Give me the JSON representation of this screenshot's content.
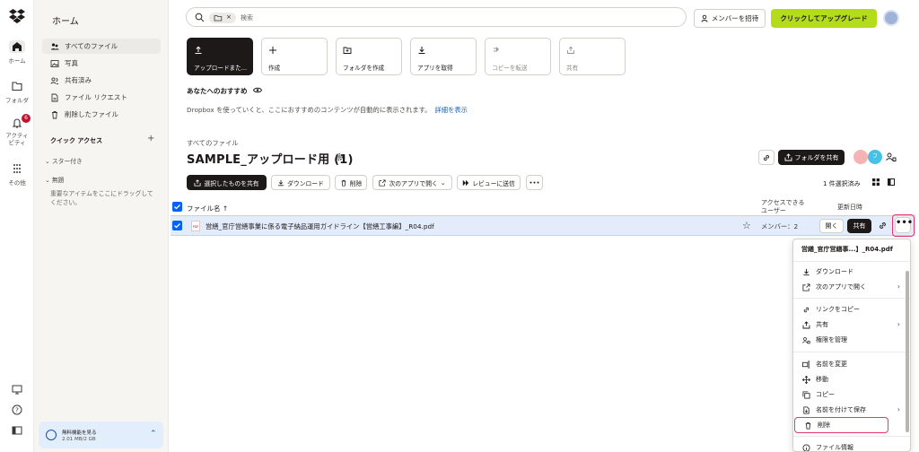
{
  "app": {
    "brand": "Dropbox",
    "accent": "#0061fe",
    "upgrade_color": "#b4dc19"
  },
  "rail": {
    "items": [
      {
        "label": "ホーム",
        "icon": "home-icon",
        "active": true
      },
      {
        "label": "フォルダ",
        "icon": "folder-icon"
      },
      {
        "label": "アクティビティ",
        "icon": "bell-icon",
        "badge": "6"
      },
      {
        "label": "その他",
        "icon": "grid-icon"
      }
    ],
    "bottom_icons": [
      "desktop-icon",
      "help-icon",
      "sidebar-toggle-icon"
    ]
  },
  "sidebar": {
    "title": "ホーム",
    "items": [
      {
        "label": "すべてのファイル",
        "icon": "files-icon",
        "active": true
      },
      {
        "label": "写真",
        "icon": "photo-icon"
      },
      {
        "label": "共有済み",
        "icon": "shared-icon"
      },
      {
        "label": "ファイル リクエスト",
        "icon": "file-request-icon"
      },
      {
        "label": "削除したファイル",
        "icon": "trash-icon"
      }
    ],
    "quick_access": "クイック アクセス",
    "starred": "スター付き",
    "untitled": "無題",
    "hint": "重要なアイテムをここにドラッグしてください。",
    "storage": {
      "title": "無料機能を見る",
      "usage": "2.01 MB/2 GB"
    }
  },
  "topbar": {
    "search_placeholder": "検索",
    "chip_close": "×",
    "invite_label": "メンバーを招待",
    "upgrade_label": "クリックしてアップグレード"
  },
  "actions": [
    {
      "label": "アップロードまた...",
      "icon": "upload-icon",
      "primary": true
    },
    {
      "label": "作成",
      "icon": "plus-icon"
    },
    {
      "label": "フォルダを作成",
      "icon": "new-folder-icon"
    },
    {
      "label": "アプリを取得",
      "icon": "download-icon"
    },
    {
      "label": "コピーを転送",
      "icon": "transfer-icon",
      "muted": true
    },
    {
      "label": "共有",
      "icon": "share-icon",
      "muted": true
    }
  ],
  "recommend": {
    "title": "あなたへのおすすめ",
    "text": "Dropbox を使っていくと、ここにおすすめのコンテンツが自動的に表示されます。",
    "link": "詳細を表示"
  },
  "folder": {
    "breadcrumb": "すべてのファイル",
    "title": "SAMPLE_アップロード用 (1)",
    "share_label": "フォルダを共有",
    "avatar2": "フ"
  },
  "toolbar": {
    "share_selected": "選択したものを共有",
    "download": "ダウンロード",
    "delete": "削除",
    "open_with": "次のアプリで開く",
    "send_review": "レビューに送信",
    "more": "•••",
    "selected_count": "1 件選択済み"
  },
  "table": {
    "columns": {
      "name": "ファイル名 ↑",
      "access": "アクセスできる\nユーザー",
      "updated": "更新日時"
    },
    "rows": [
      {
        "name": "営繕_官庁営繕事業に係る電子納品運用ガイドライン【営繕工事編】_R04.pdf",
        "file_type": "PDF",
        "members": "メンバー：2",
        "open": "開く",
        "share": "共有",
        "more": "•••"
      }
    ]
  },
  "context_menu": {
    "title": "営繕_官庁営繕事...】_R04.pdf",
    "items": [
      {
        "label": "ダウンロード",
        "icon": "download-icon"
      },
      {
        "label": "次のアプリで開く",
        "icon": "open-external-icon",
        "submenu": true
      },
      {
        "label": "リンクをコピー",
        "icon": "link-icon"
      },
      {
        "label": "共有",
        "icon": "share-icon",
        "submenu": true
      },
      {
        "label": "権限を管理",
        "icon": "manage-access-icon"
      },
      {
        "label": "名前を変更",
        "icon": "rename-icon"
      },
      {
        "label": "移動",
        "icon": "move-icon"
      },
      {
        "label": "コピー",
        "icon": "copy-icon"
      },
      {
        "label": "名前を付けて保存",
        "icon": "save-as-icon",
        "submenu": true
      },
      {
        "label": "削除",
        "icon": "trash-icon",
        "highlighted": true
      },
      {
        "label": "ファイル情報",
        "icon": "info-icon"
      }
    ]
  }
}
